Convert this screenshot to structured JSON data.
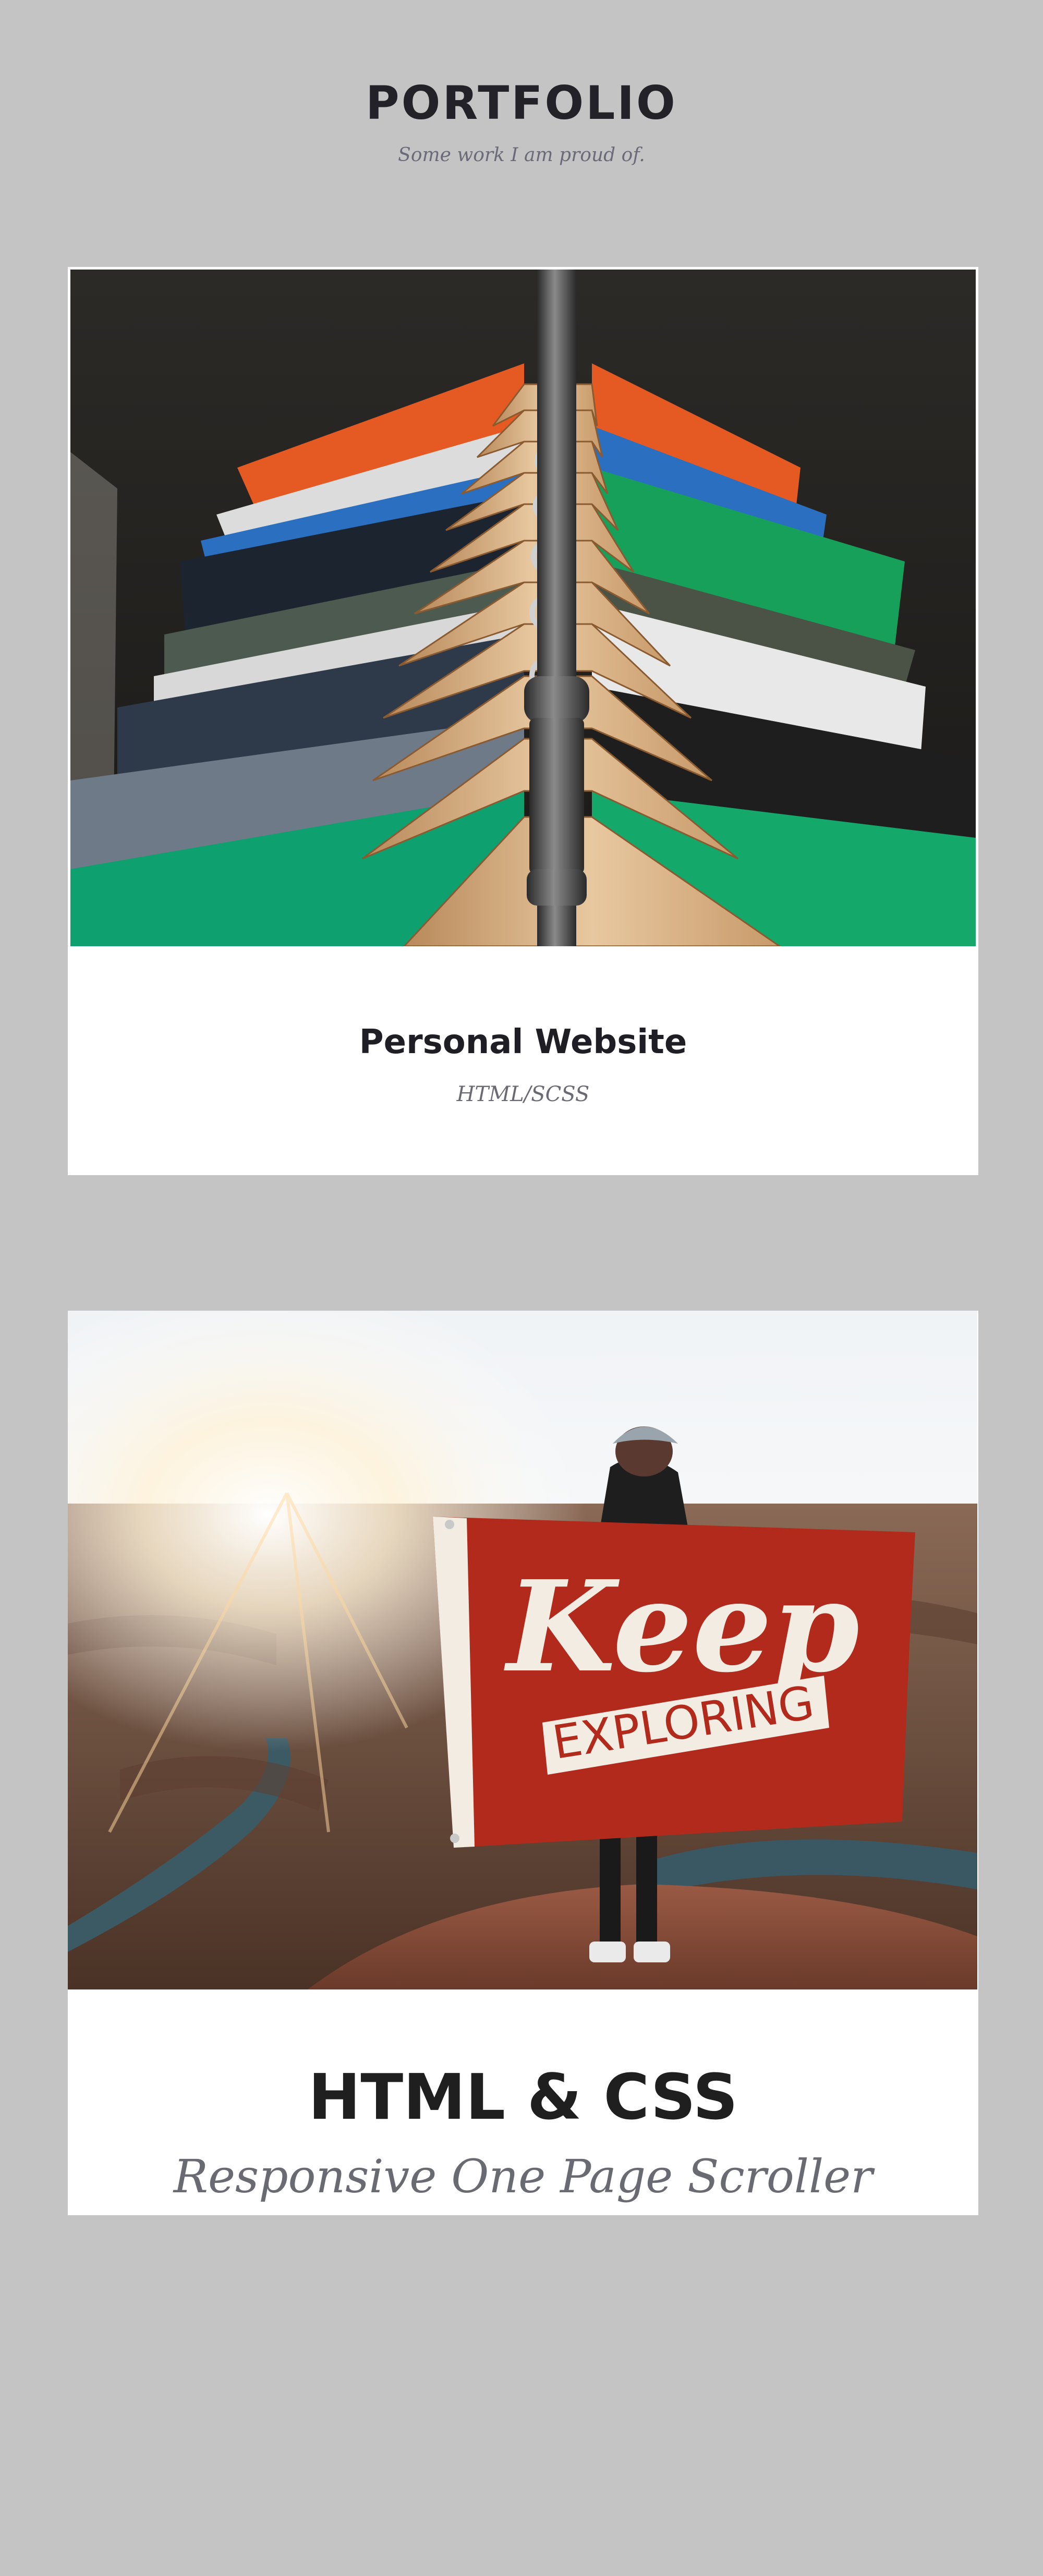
{
  "header": {
    "title": "PORTFOLIO",
    "subtitle": "Some work I am proud of."
  },
  "projects": [
    {
      "title": "Personal Website",
      "tags": "HTML/SCSS",
      "image_icon": "clothes-rack-photo"
    },
    {
      "title": "HTML & CSS",
      "tags": "Responsive One Page Scroller",
      "image_icon": "keep-exploring-flag-photo",
      "flag_text_top": "Keep",
      "flag_text_bottom": "EXPLORING"
    }
  ]
}
